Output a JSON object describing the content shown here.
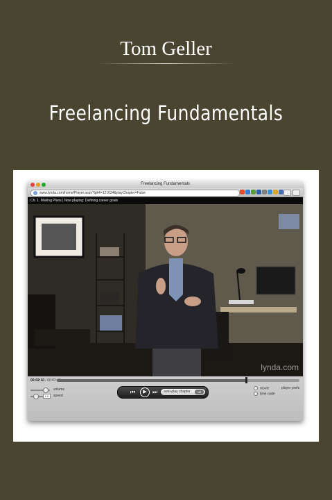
{
  "cover": {
    "author": "Tom Geller",
    "course_title": "Freelancing Fundamentals"
  },
  "browser": {
    "window_title": "Freelancing Fundamentals",
    "url": "www.lynda.com/home/Player.aspx?lpk4=121634&playChapter=False"
  },
  "player": {
    "now_playing": "Ch. 1. Making Plans | Now playing: Defining career goals",
    "time_current": "00:02:10",
    "time_total": "00:02:48",
    "progress": 0.78,
    "volume_label": "volume",
    "speed_label": "speed",
    "speed_value": "1.0",
    "autoplay_label": "auto-play chapter",
    "autoplay_state": "off",
    "prefs_title": "player prefs",
    "pref_movie": "movie",
    "pref_time_code": "time code",
    "watermark": "lynda.com"
  },
  "icons": {
    "prev": "skip-back-icon",
    "play": "play-icon",
    "next": "skip-forward-icon"
  }
}
